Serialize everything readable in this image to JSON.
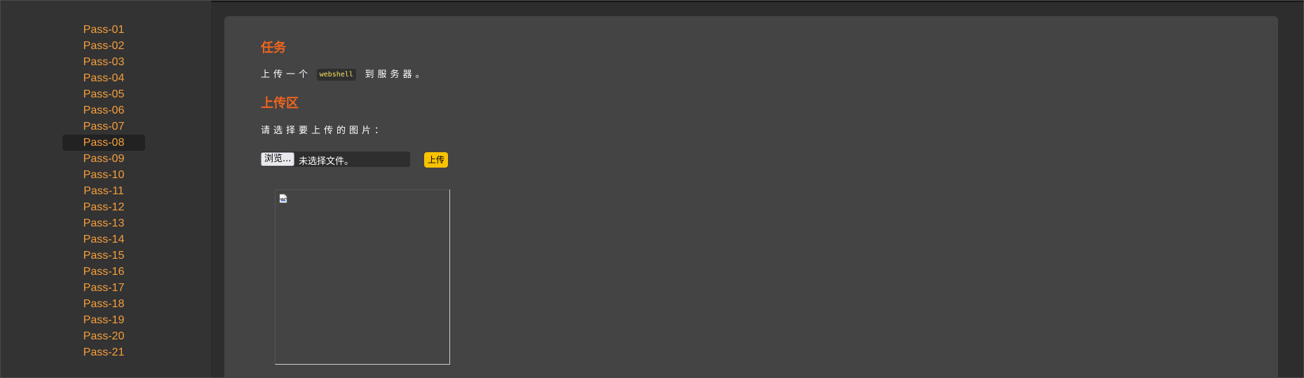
{
  "sidebar": {
    "items": [
      {
        "label": "Pass-01"
      },
      {
        "label": "Pass-02"
      },
      {
        "label": "Pass-03"
      },
      {
        "label": "Pass-04"
      },
      {
        "label": "Pass-05"
      },
      {
        "label": "Pass-06"
      },
      {
        "label": "Pass-07"
      },
      {
        "label": "Pass-08"
      },
      {
        "label": "Pass-09"
      },
      {
        "label": "Pass-10"
      },
      {
        "label": "Pass-11"
      },
      {
        "label": "Pass-12"
      },
      {
        "label": "Pass-13"
      },
      {
        "label": "Pass-14"
      },
      {
        "label": "Pass-15"
      },
      {
        "label": "Pass-16"
      },
      {
        "label": "Pass-17"
      },
      {
        "label": "Pass-18"
      },
      {
        "label": "Pass-19"
      },
      {
        "label": "Pass-20"
      },
      {
        "label": "Pass-21"
      }
    ],
    "active_item": "Pass-08"
  },
  "task": {
    "title": "任务",
    "text_before": "上传一个",
    "code": "webshell",
    "text_after": "到服务器。"
  },
  "upload": {
    "title": "上传区",
    "prompt": "请选择要上传的图片：",
    "browse_label": "浏览...",
    "file_status": "未选择文件。",
    "submit_label": "上传"
  },
  "preview": {
    "icon": "broken-image-icon"
  },
  "colors": {
    "accent_orange": "#f0641e",
    "link_orange": "#f59e3c",
    "button_yellow": "#f8c200",
    "code_yellow": "#f6e05e",
    "panel_bg": "#444444",
    "sidebar_bg": "#333333"
  }
}
